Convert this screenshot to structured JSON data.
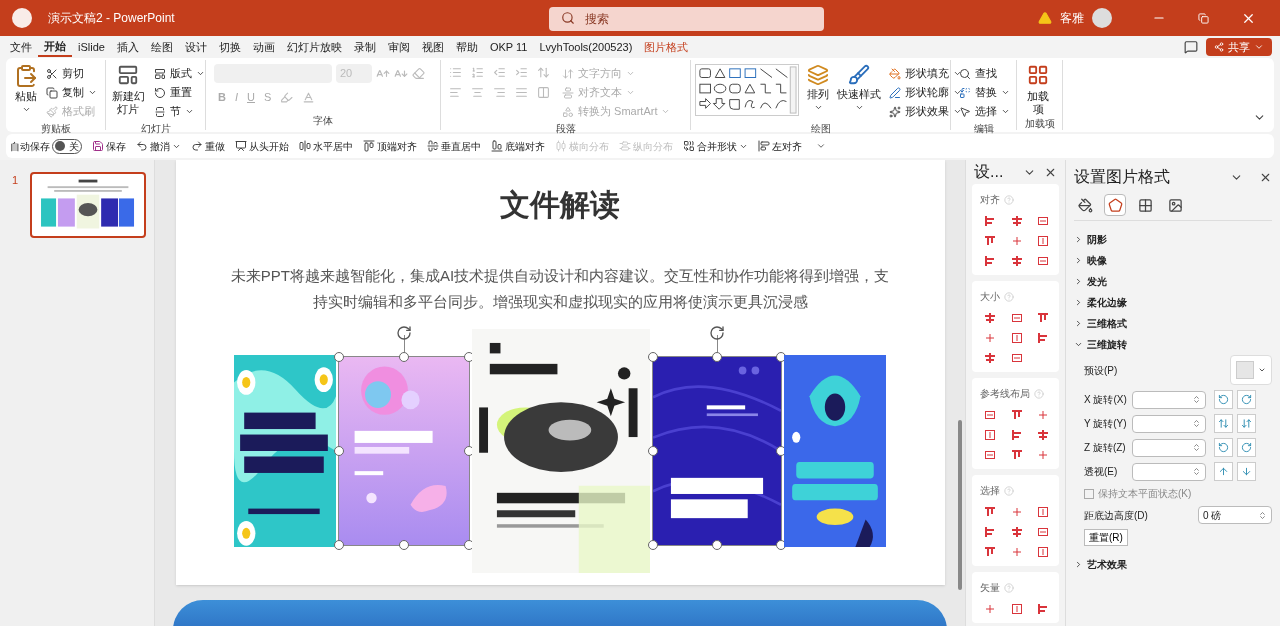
{
  "window": {
    "title": "演示文稿2 - PowerPoint",
    "search": {
      "placeholder": "搜索"
    },
    "user": "客雅"
  },
  "tabs": [
    {
      "label": "文件",
      "selected": false,
      "kind": "normal"
    },
    {
      "label": "开始",
      "selected": true,
      "kind": "normal"
    },
    {
      "label": "iSlide",
      "selected": false,
      "kind": "normal"
    },
    {
      "label": "插入",
      "selected": false,
      "kind": "normal"
    },
    {
      "label": "绘图",
      "selected": false,
      "kind": "normal"
    },
    {
      "label": "设计",
      "selected": false,
      "kind": "normal"
    },
    {
      "label": "切换",
      "selected": false,
      "kind": "normal"
    },
    {
      "label": "动画",
      "selected": false,
      "kind": "normal"
    },
    {
      "label": "幻灯片放映",
      "selected": false,
      "kind": "normal"
    },
    {
      "label": "录制",
      "selected": false,
      "kind": "normal"
    },
    {
      "label": "审阅",
      "selected": false,
      "kind": "normal"
    },
    {
      "label": "视图",
      "selected": false,
      "kind": "normal"
    },
    {
      "label": "帮助",
      "selected": false,
      "kind": "normal"
    },
    {
      "label": "OKP 11",
      "selected": false,
      "kind": "normal"
    },
    {
      "label": "LvyhTools(200523)",
      "selected": false,
      "kind": "normal"
    },
    {
      "label": "图片格式",
      "selected": false,
      "kind": "contextual"
    }
  ],
  "share_button": "共享",
  "ribbon": {
    "groups": [
      {
        "kind": "clipboard",
        "label": "剪贴板",
        "items": [
          {
            "label": "粘贴",
            "disabled": false
          },
          {
            "label": "剪切",
            "disabled": false
          },
          {
            "label": "复制",
            "disabled": false
          },
          {
            "label": "格式刷",
            "disabled": true
          }
        ]
      },
      {
        "kind": "slides",
        "label": "幻灯片",
        "items": [
          {
            "label": "新建幻灯片",
            "disabled": false
          },
          {
            "label": "版式",
            "disabled": false
          },
          {
            "label": "重置",
            "disabled": false
          },
          {
            "label": "节",
            "disabled": false
          }
        ]
      },
      {
        "kind": "font",
        "label": "字体",
        "font_size": "20",
        "format_buttons": [
          "B",
          "I",
          "U",
          "S"
        ]
      },
      {
        "kind": "paragraph",
        "label": "段落",
        "items": [
          {
            "label": "文字方向",
            "disabled": true
          },
          {
            "label": "对齐文本",
            "disabled": true
          },
          {
            "label": "转换为 SmartArt",
            "disabled": true
          }
        ]
      },
      {
        "kind": "drawing",
        "label": "绘图",
        "items": [
          {
            "label": "排列",
            "disabled": false
          },
          {
            "label": "快速样式",
            "disabled": false
          },
          {
            "label": "形状填充",
            "disabled": false
          },
          {
            "label": "形状轮廓",
            "disabled": false
          },
          {
            "label": "形状效果",
            "disabled": false
          }
        ]
      },
      {
        "kind": "editing",
        "label": "编辑",
        "items": [
          {
            "label": "查找",
            "disabled": false
          },
          {
            "label": "替换",
            "disabled": false
          },
          {
            "label": "选择",
            "disabled": false
          }
        ]
      },
      {
        "kind": "addins",
        "label": "加载项",
        "items": [
          {
            "label": "加载项",
            "disabled": false
          }
        ]
      }
    ]
  },
  "quick_access": {
    "autosave": {
      "label": "自动保存",
      "on": false,
      "state_label": "关"
    },
    "items": [
      {
        "label": "保存",
        "disabled": false
      },
      {
        "label": "撤消",
        "disabled": false
      },
      {
        "label": "重做",
        "disabled": false
      },
      {
        "label": "从头开始",
        "disabled": false
      },
      {
        "label": "水平居中",
        "disabled": false
      },
      {
        "label": "顶端对齐",
        "disabled": false
      },
      {
        "label": "垂直居中",
        "disabled": false
      },
      {
        "label": "底端对齐",
        "disabled": false
      },
      {
        "label": "横向分布",
        "disabled": true
      },
      {
        "label": "纵向分布",
        "disabled": true
      },
      {
        "label": "合并形状",
        "disabled": false
      },
      {
        "label": "左对齐",
        "disabled": false
      }
    ]
  },
  "thumbnails": [
    {
      "number": "1",
      "selected": true
    }
  ],
  "slide": {
    "title": "文件解读",
    "body": "未来PPT将越来越智能化，集成AI技术提供自动设计和内容建议。交互性和协作功能将得到增强，支持实时编辑和多平台同步。增强现实和虚拟现实的应用将使演示更具沉浸感",
    "posters": [
      {
        "kind": "picture",
        "selected": false
      },
      {
        "kind": "picture",
        "selected": true
      },
      {
        "kind": "picture",
        "selected": false
      },
      {
        "kind": "picture",
        "selected": true
      },
      {
        "kind": "picture",
        "selected": false
      }
    ]
  },
  "tools_pane": {
    "title": "设...",
    "sections": [
      {
        "title": "对齐"
      },
      {
        "title": "大小"
      },
      {
        "title": "参考线布局"
      },
      {
        "title": "选择"
      },
      {
        "title": "矢量"
      }
    ]
  },
  "format_pane": {
    "title": "设置图片格式",
    "tabs": [
      {
        "selected": false
      },
      {
        "selected": true
      },
      {
        "selected": false
      },
      {
        "selected": false
      }
    ],
    "sections": [
      {
        "title": "阴影",
        "expanded": false
      },
      {
        "title": "映像",
        "expanded": false
      },
      {
        "title": "发光",
        "expanded": false
      },
      {
        "title": "柔化边缘",
        "expanded": false
      },
      {
        "title": "三维格式",
        "expanded": false
      },
      {
        "title": "三维旋转",
        "expanded": true
      },
      {
        "title": "艺术效果",
        "expanded": false
      }
    ],
    "rotation": {
      "preset_label": "预设(P)",
      "fields": [
        {
          "label": "X 旋转(X)"
        },
        {
          "label": "Y 旋转(Y)"
        },
        {
          "label": "Z 旋转(Z)"
        },
        {
          "label": "透视(E)"
        }
      ],
      "keep_flat": {
        "label": "保持文本平面状态(K)",
        "checked": false,
        "disabled": true
      },
      "distance": {
        "label": "距底边高度(D)",
        "value": "0 磅"
      },
      "reset_button": "重置(R)"
    }
  }
}
